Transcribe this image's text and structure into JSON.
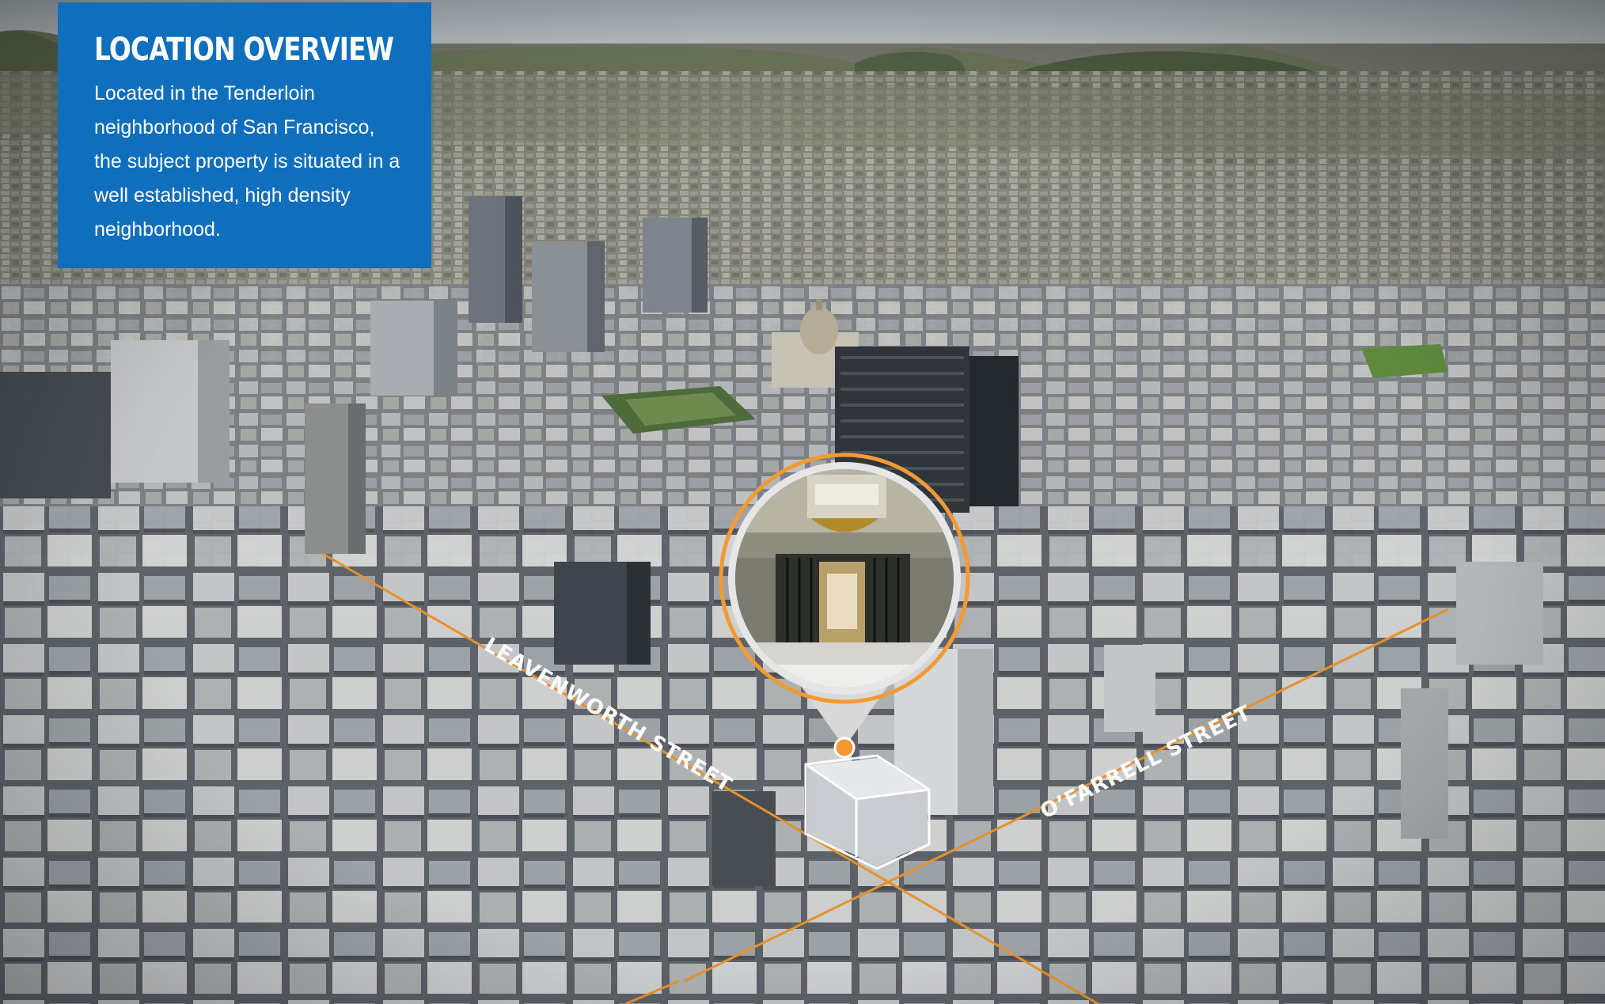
{
  "overview": {
    "title": "LOCATION OVERVIEW",
    "description": "Located in the Tenderloin neighborhood of San Francisco, the subject property is situated in a well established, high density neighborhood."
  },
  "map": {
    "view": "aerial-3d",
    "streets": [
      {
        "name": "LEAVENWORTH  STREET",
        "line_color": "#e8912c"
      },
      {
        "name": "O’FARRELL STREET",
        "line_color": "#e8912c"
      }
    ],
    "subject_property": {
      "marker_color": "#f39a33",
      "outline_color": "#ffffff",
      "photo_icon": "building-entrance-photo"
    },
    "colors": {
      "panel": "#0f6fbd",
      "street_lines": "#e8912c",
      "marker": "#f39a33"
    }
  }
}
